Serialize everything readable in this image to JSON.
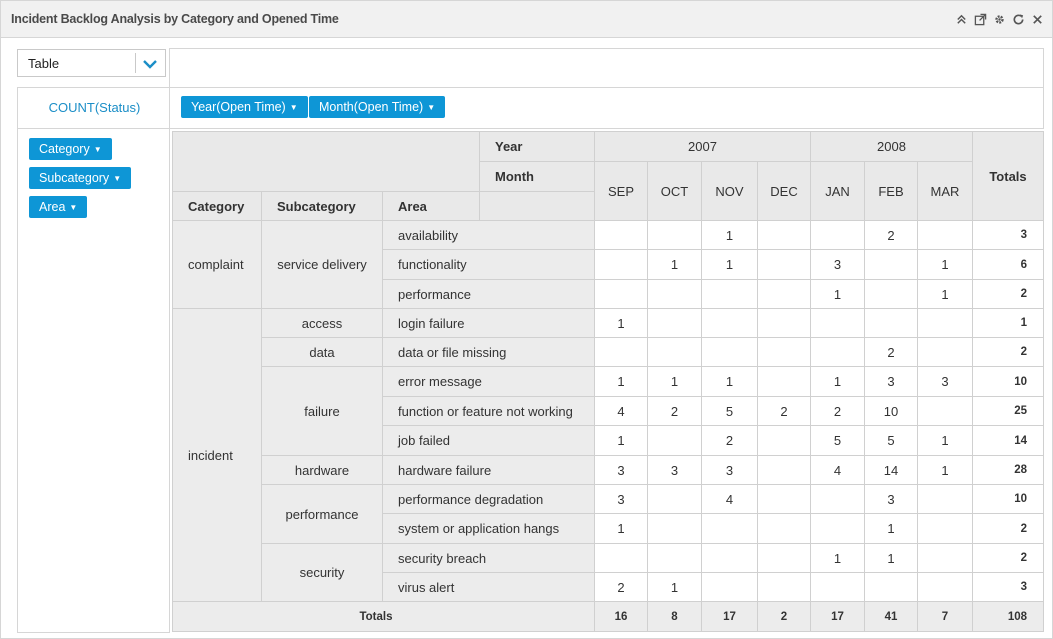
{
  "panel": {
    "title": "Incident Backlog Analysis by Category and Opened Time",
    "icons": [
      "collapse-icon",
      "popout-icon",
      "settings-icon",
      "refresh-icon",
      "close-icon"
    ]
  },
  "view_select": {
    "value": "Table"
  },
  "measure": {
    "label": "COUNT(Status)"
  },
  "column_pills": [
    "Year(Open Time)",
    "Month(Open Time)"
  ],
  "row_pills": [
    "Category",
    "Subcategory",
    "Area"
  ],
  "pivot": {
    "col_headers": {
      "year_label": "Year",
      "month_label": "Month",
      "totals_label": "Totals"
    },
    "row_headers": [
      "Category",
      "Subcategory",
      "Area"
    ],
    "years": [
      {
        "label": "2007",
        "months": [
          "SEP",
          "OCT",
          "NOV",
          "DEC"
        ]
      },
      {
        "label": "2008",
        "months": [
          "JAN",
          "FEB",
          "MAR"
        ]
      }
    ],
    "rows": [
      {
        "category": "complaint",
        "subcategory": "service delivery",
        "area": "availability",
        "values": [
          "",
          "",
          "1",
          "",
          "",
          "2",
          ""
        ],
        "total": "3"
      },
      {
        "category": "complaint",
        "subcategory": "service delivery",
        "area": "functionality",
        "values": [
          "",
          "1",
          "1",
          "",
          "3",
          "",
          "1"
        ],
        "total": "6"
      },
      {
        "category": "complaint",
        "subcategory": "service delivery",
        "area": "performance",
        "values": [
          "",
          "",
          "",
          "",
          "1",
          "",
          "1"
        ],
        "total": "2"
      },
      {
        "category": "incident",
        "subcategory": "access",
        "area": "login failure",
        "values": [
          "1",
          "",
          "",
          "",
          "",
          "",
          ""
        ],
        "total": "1"
      },
      {
        "category": "incident",
        "subcategory": "data",
        "area": "data or file missing",
        "values": [
          "",
          "",
          "",
          "",
          "",
          "2",
          ""
        ],
        "total": "2"
      },
      {
        "category": "incident",
        "subcategory": "failure",
        "area": "error message",
        "values": [
          "1",
          "1",
          "1",
          "",
          "1",
          "3",
          "3"
        ],
        "total": "10"
      },
      {
        "category": "incident",
        "subcategory": "failure",
        "area": "function or feature not working",
        "values": [
          "4",
          "2",
          "5",
          "2",
          "2",
          "10",
          ""
        ],
        "total": "25"
      },
      {
        "category": "incident",
        "subcategory": "failure",
        "area": "job failed",
        "values": [
          "1",
          "",
          "2",
          "",
          "5",
          "5",
          "1"
        ],
        "total": "14"
      },
      {
        "category": "incident",
        "subcategory": "hardware",
        "area": "hardware failure",
        "values": [
          "3",
          "3",
          "3",
          "",
          "4",
          "14",
          "1"
        ],
        "total": "28"
      },
      {
        "category": "incident",
        "subcategory": "performance",
        "area": "performance degradation",
        "values": [
          "3",
          "",
          "4",
          "",
          "",
          "3",
          ""
        ],
        "total": "10"
      },
      {
        "category": "incident",
        "subcategory": "performance",
        "area": "system or application hangs",
        "values": [
          "1",
          "",
          "",
          "",
          "",
          "1",
          ""
        ],
        "total": "2"
      },
      {
        "category": "incident",
        "subcategory": "security",
        "area": "security breach",
        "values": [
          "",
          "",
          "",
          "",
          "1",
          "1",
          ""
        ],
        "total": "2"
      },
      {
        "category": "incident",
        "subcategory": "security",
        "area": "virus alert",
        "values": [
          "2",
          "1",
          "",
          "",
          "",
          "",
          ""
        ],
        "total": "3"
      }
    ],
    "footer": {
      "label": "Totals",
      "values": [
        "16",
        "8",
        "17",
        "2",
        "17",
        "41",
        "7"
      ],
      "grand_total": "108"
    }
  }
}
